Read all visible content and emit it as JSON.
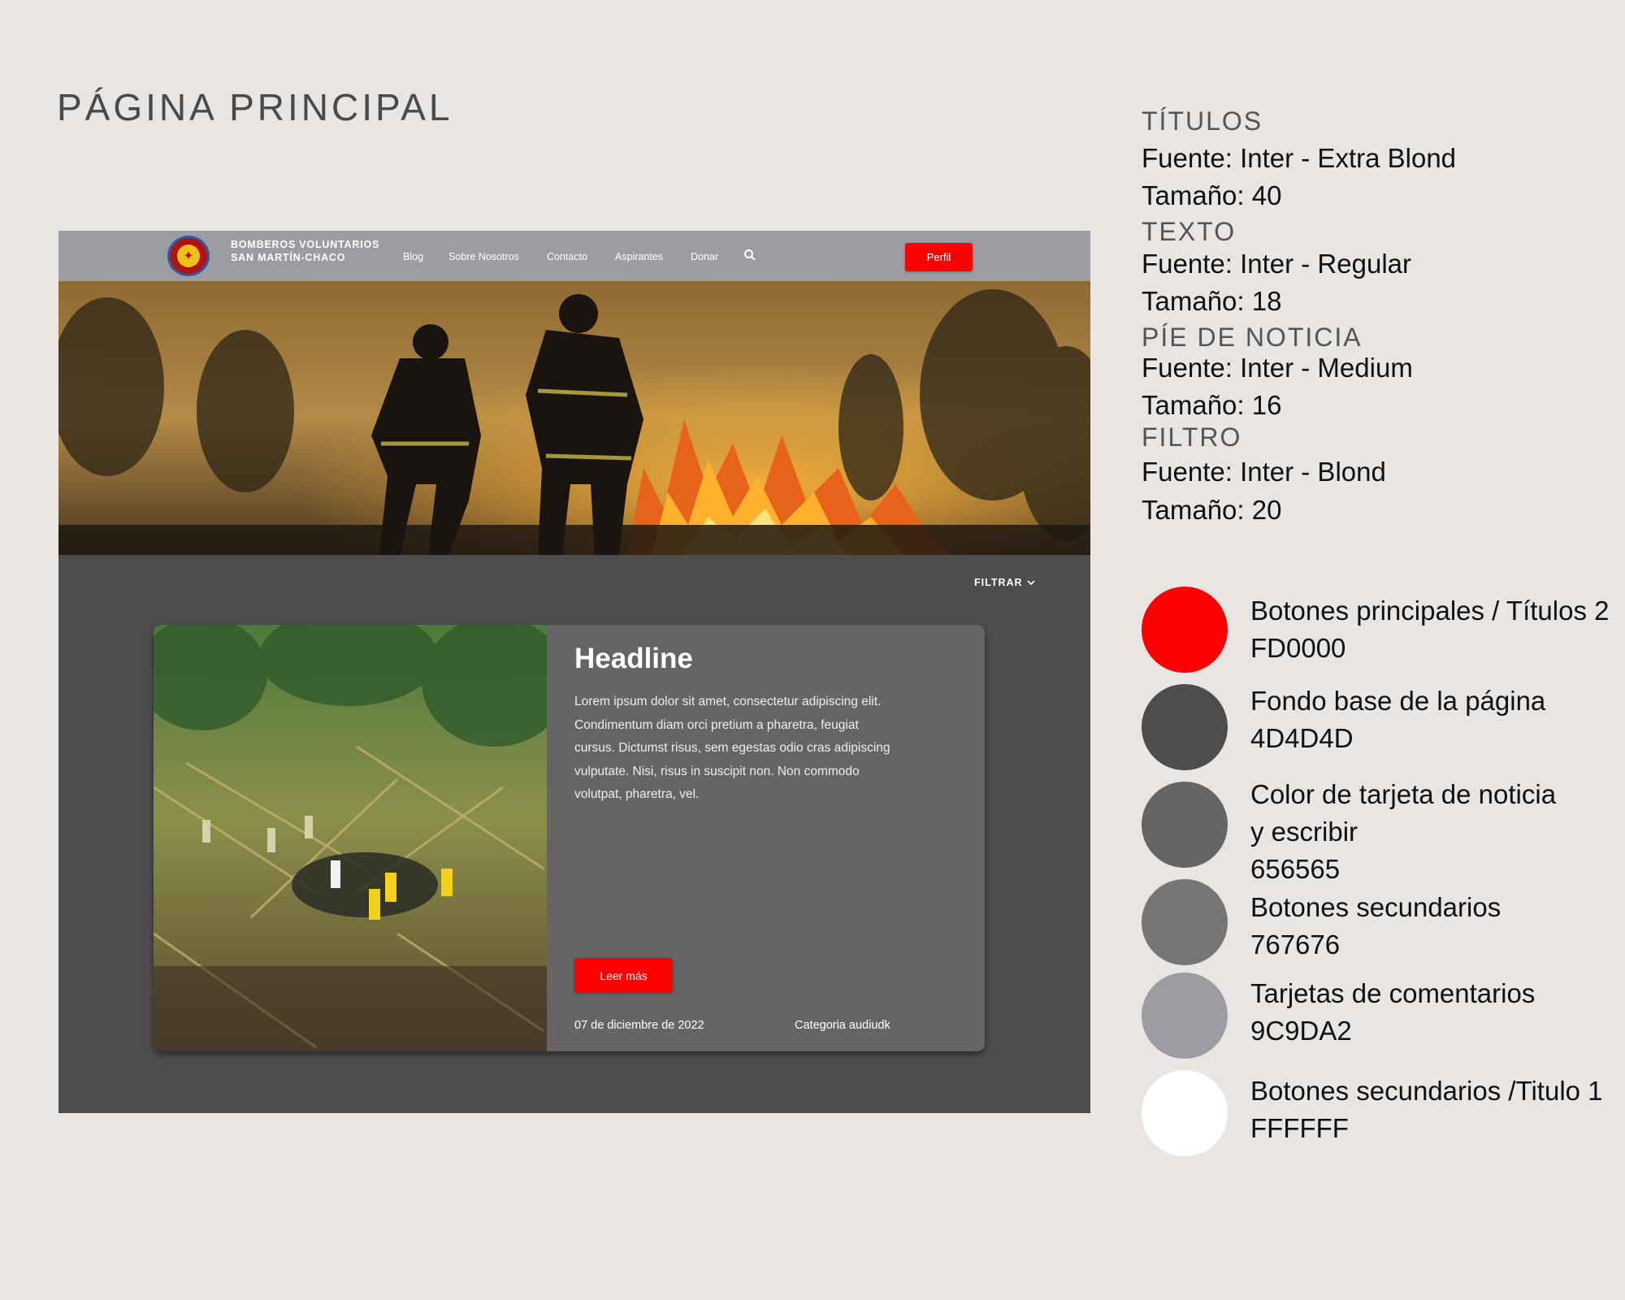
{
  "page_title": "PÁGINA PRINCIPAL",
  "mockup": {
    "navbar": {
      "brand_line1": "BOMBEROS VOLUNTARIOS",
      "brand_line2": "SAN MARTÍN-CHACO",
      "items": [
        "Blog",
        "Sobre Nosotros",
        "Contacto",
        "Aspirantes",
        "Donar"
      ],
      "search_icon": "search-icon",
      "profile_button": "Perfil"
    },
    "filter_label": "FILTRAR",
    "card": {
      "headline": "Headline",
      "body": "Lorem ipsum dolor sit amet, consectetur adipiscing elit. Condimentum diam orci pretium a pharetra, feugiat cursus. Dictumst risus, sem egestas odio cras adipiscing vulputate. Nisi, risus in suscipit non. Non commodo volutpat, pharetra, vel.",
      "button": "Leer más",
      "date": "07 de diciembre de 2022",
      "category": "Categoria audiudk"
    }
  },
  "typography": [
    {
      "heading": "TÍTULOS",
      "font": "Fuente: Inter - Extra Blond",
      "size": "Tamaño: 40"
    },
    {
      "heading": "TEXTO",
      "font": "Fuente: Inter - Regular",
      "size": "Tamaño: 18"
    },
    {
      "heading": "PÍE DE NOTICIA",
      "font": "Fuente: Inter - Medium",
      "size": "Tamaño: 16"
    },
    {
      "heading": "FILTRO",
      "font": "Fuente: Inter - Blond",
      "size": "Tamaño: 20"
    }
  ],
  "palette": [
    {
      "color": "#FD0000",
      "label_lines": [
        "Botones principales / Títulos 2",
        "FD0000"
      ]
    },
    {
      "color": "#4D4D4D",
      "label_lines": [
        "Fondo base de la página",
        "4D4D4D"
      ]
    },
    {
      "color": "#656565",
      "label_lines": [
        "Color de tarjeta de noticia",
        "y escribir",
        "656565"
      ]
    },
    {
      "color": "#767676",
      "label_lines": [
        "Botones secundarios",
        "767676"
      ]
    },
    {
      "color": "#9C9DA2",
      "label_lines": [
        "Tarjetas de comentarios",
        "9C9DA2"
      ]
    },
    {
      "color": "#FFFFFF",
      "label_lines": [
        "Botones secundarios /Titulo 1",
        "FFFFFF"
      ]
    }
  ]
}
